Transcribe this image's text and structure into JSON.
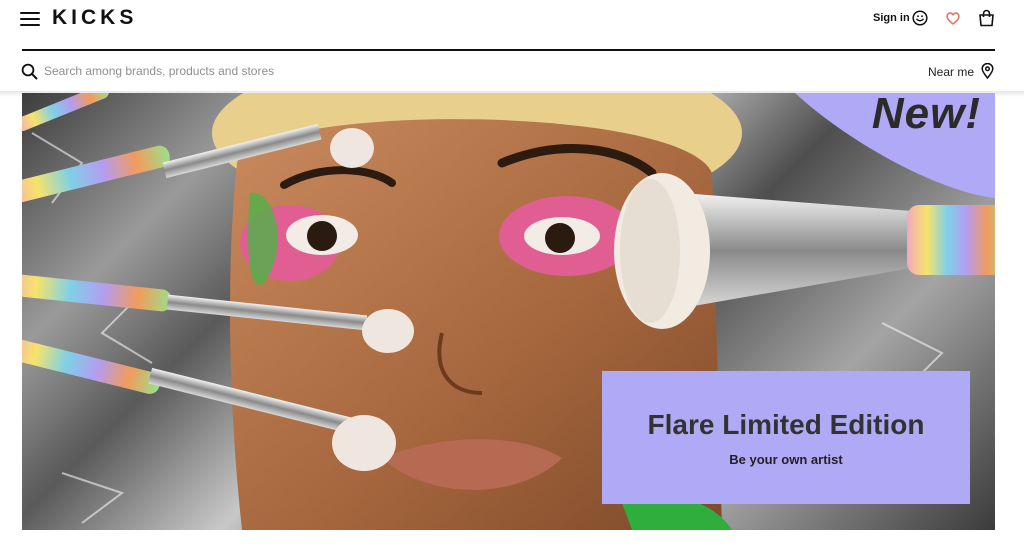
{
  "header": {
    "logo": "KICKS",
    "sign_in_label": "Sign in"
  },
  "search": {
    "placeholder": "Search among brands, products and stores",
    "near_me_label": "Near me"
  },
  "hero": {
    "badge_text": "New!",
    "title": "Flare Limited Edition",
    "subtitle": "Be your own artist",
    "badge_color": "#b0a9f5"
  },
  "icons": [
    "menu-icon",
    "smiley-icon",
    "heart-icon",
    "bag-icon",
    "search-icon",
    "location-pin-icon"
  ],
  "colors": {
    "accent_heart": "#e8736a",
    "promo_lavender": "#b0a9f5",
    "text_dark": "#111111"
  }
}
